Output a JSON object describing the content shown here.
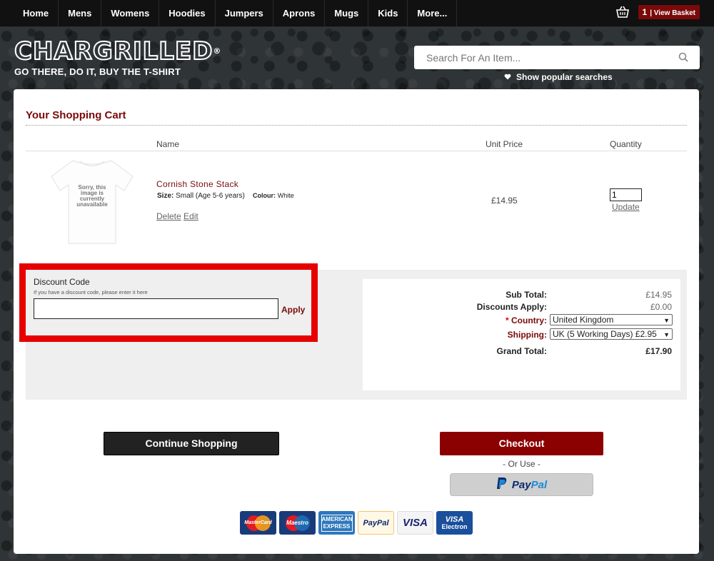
{
  "nav": {
    "items": [
      "Home",
      "Mens",
      "Womens",
      "Hoodies",
      "Jumpers",
      "Aprons",
      "Mugs",
      "Kids",
      "More..."
    ],
    "basket_count": "1",
    "basket_label": "| View Basket"
  },
  "header": {
    "logo": "CHARGRILLED",
    "logo_mark": "®",
    "tagline": "GO THERE, DO IT, BUY THE T-SHIRT",
    "search_placeholder": "Search For An Item...",
    "popular_searches": "Show popular searches"
  },
  "cart": {
    "title": "Your Shopping Cart",
    "col_name": "Name",
    "col_unit_price": "Unit Price",
    "col_quantity": "Quantity",
    "item": {
      "image_text": "Sorry, this image is currently unavailable",
      "name": "Cornish Stone Stack",
      "size_label": "Size:",
      "size_value": "Small (Age 5-6 years)",
      "colour_label": "Colour:",
      "colour_value": "White",
      "delete_label": "Delete",
      "edit_label": "Edit",
      "unit_price": "£14.95",
      "quantity": "1",
      "update_label": "Update"
    }
  },
  "discount": {
    "title": "Discount Code",
    "help": "If you have a discount code, please enter it here",
    "value": "",
    "apply_label": "Apply"
  },
  "totals": {
    "sub_total_label": "Sub Total:",
    "sub_total": "£14.95",
    "discounts_label": "Discounts Apply:",
    "discounts": "£0.00",
    "country_star": "*",
    "country_label": "Country:",
    "country_value": "United Kingdom",
    "shipping_label": "Shipping:",
    "shipping_value": "UK (5 Working Days) £2.95",
    "grand_total_label": "Grand Total:",
    "grand_total": "£17.90"
  },
  "actions": {
    "continue_label": "Continue Shopping",
    "checkout_label": "Checkout",
    "or_use": "- Or Use -",
    "paypal_pay": "Pay",
    "paypal_pal": "Pal"
  },
  "payment_cards": {
    "mastercard": "MasterCard",
    "maestro": "Maestro",
    "amex": "AMERICAN EXPRESS",
    "paypal": "PayPal",
    "visa": "VISA",
    "visa_electron_top": "VISA",
    "visa_electron_bottom": "Electron"
  },
  "colors": {
    "brand_red": "#7a0a0a",
    "checkout_red": "#8b0000",
    "highlight_red": "#e60000",
    "nav_bg": "#111111"
  }
}
